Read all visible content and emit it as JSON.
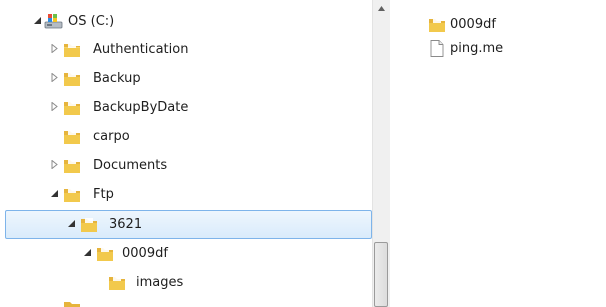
{
  "tree": {
    "items": [
      {
        "label": "OS (C:)",
        "icon": "drive-icon",
        "expander": "expanded"
      },
      {
        "label": "Authentication",
        "icon": "folder-icon",
        "expander": "collapsed"
      },
      {
        "label": "Backup",
        "icon": "folder-icon",
        "expander": "collapsed"
      },
      {
        "label": "BackupByDate",
        "icon": "folder-icon",
        "expander": "collapsed"
      },
      {
        "label": "carpo",
        "icon": "folder-icon",
        "expander": "none"
      },
      {
        "label": "Documents",
        "icon": "folder-icon",
        "expander": "collapsed"
      },
      {
        "label": "Ftp",
        "icon": "folder-icon",
        "expander": "expanded"
      },
      {
        "label": "3621",
        "icon": "folder-icon",
        "expander": "expanded",
        "selected": true
      },
      {
        "label": "0009df",
        "icon": "folder-icon",
        "expander": "expanded"
      },
      {
        "label": "images",
        "icon": "folder-icon",
        "expander": "none"
      }
    ]
  },
  "files": {
    "items": [
      {
        "label": "0009df",
        "icon": "folder-icon"
      },
      {
        "label": "ping.me",
        "icon": "document-icon"
      }
    ]
  },
  "colors": {
    "selection_border": "#7eb4ea",
    "folder_yellow": "#f2c94c",
    "arrow_gray": "#8c8c8c"
  }
}
